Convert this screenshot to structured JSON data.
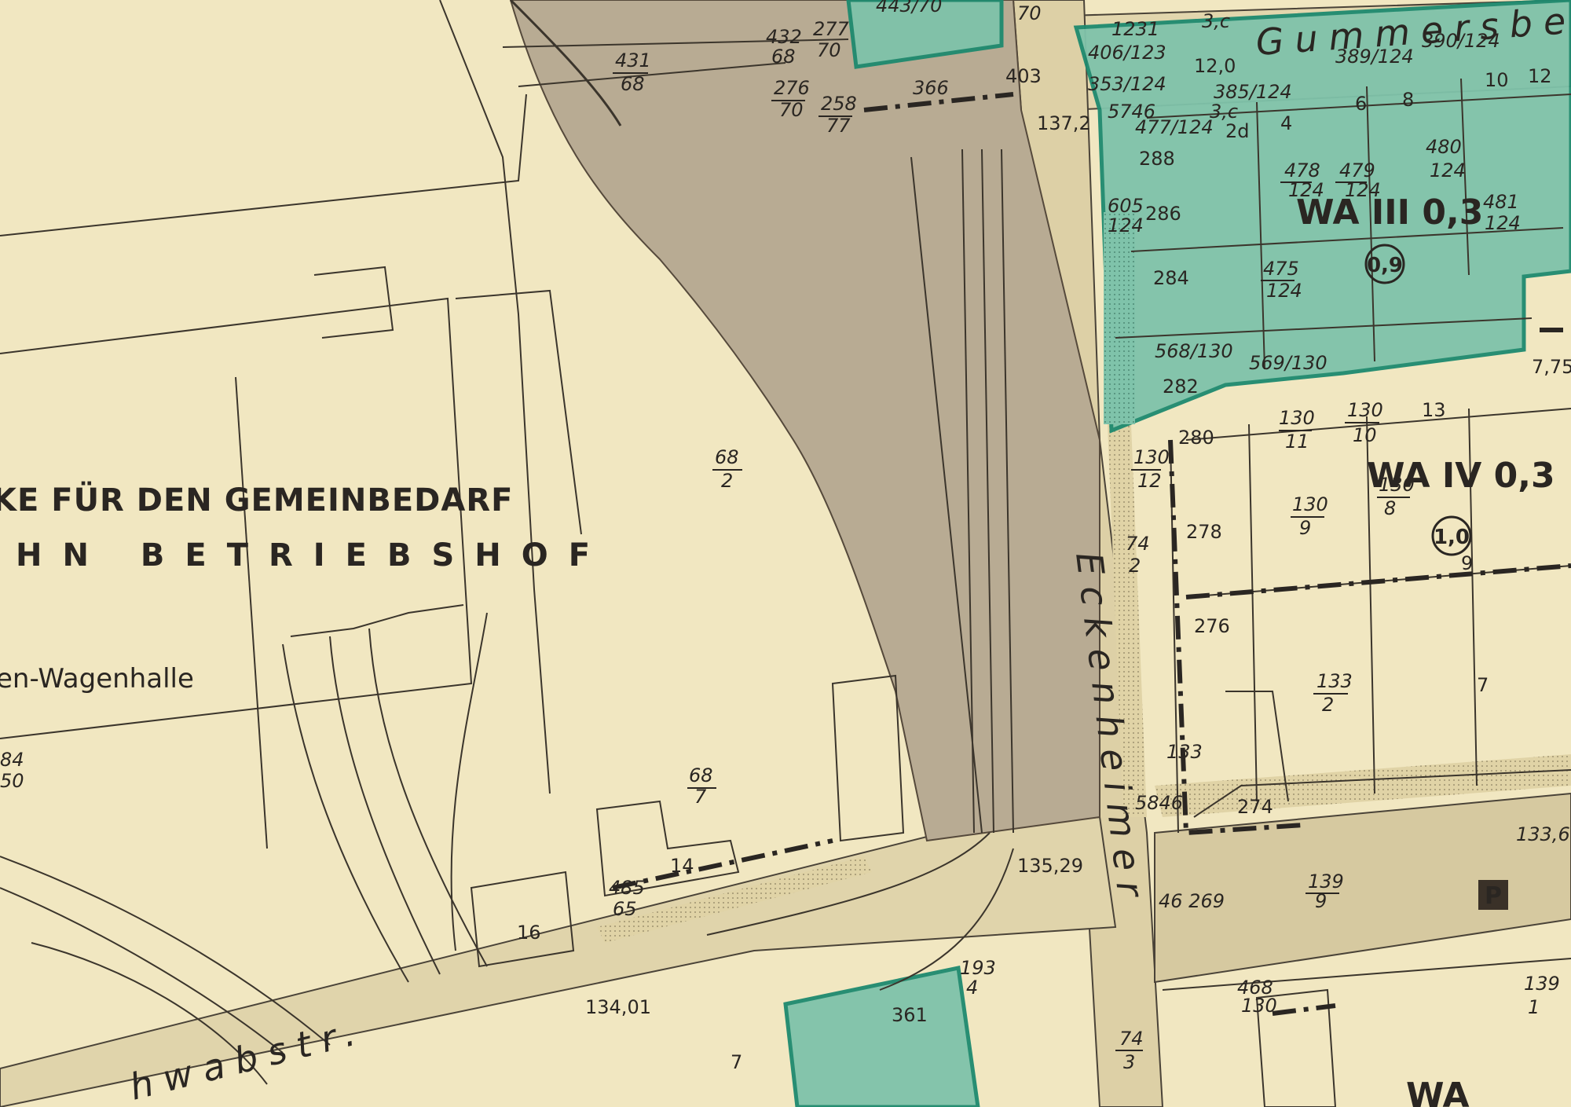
{
  "title_line_1": "KE FÜR DEN GEMEINBEDARF",
  "title_line_2": "HN BETRIEBSHOF",
  "hall_label": "en-Wagenhalle",
  "streets": {
    "gummersbacher": "Gummersbe",
    "eckenheimer": "Eckenheimer",
    "schwab": "hwabstr."
  },
  "zones": {
    "wa3": "WA III 0,3",
    "wa4": "WA IV 0,3",
    "wa_bottom": "WA",
    "gfz_09": "0,9",
    "gfz_10": "1,0"
  },
  "parking_symbol": "P",
  "elevations": [
    "137,2",
    "135,29",
    "134,01",
    "133,6",
    "7,75",
    "12,0"
  ],
  "parcels": {
    "p443_70": "443/70",
    "p70a": "70",
    "p1231": "1231",
    "p3c_top": "3,c",
    "p406": "406/123",
    "p389": "389/124",
    "p390": "390/124",
    "p353": "353/124",
    "p385": "385/124",
    "p477": "477/124",
    "p3c_mid": "3,c",
    "p2d": "2d",
    "p4": "4",
    "p6": "6",
    "p8": "8",
    "p10": "10",
    "p12": "12",
    "p288": "288",
    "p478_n": "478",
    "p478_d": "124",
    "p479_n": "479",
    "p479_d": "124",
    "p480_n": "480",
    "p480_d": "124",
    "p481_n": "481",
    "p481_d": "124",
    "p605_n": "605",
    "p605_d": "124",
    "p286": "286",
    "p284": "284",
    "p475_n": "475",
    "p475_d": "124",
    "p568": "568/130",
    "p569": "569/130",
    "p282": "282",
    "p280": "280",
    "p130_11_n": "130",
    "p130_11_d": "11",
    "p130_10_n": "130",
    "p130_10_d": "10",
    "p13": "13",
    "p130_12_n": "130",
    "p130_12_d": "12",
    "p130_9_n": "130",
    "p130_9_d": "9",
    "p130_8_n": "130",
    "p130_8_d": "8",
    "p278": "278",
    "p9": "9",
    "p74_2_n": "74",
    "p74_2_d": "2",
    "p276": "276",
    "p133_2_n": "133",
    "p133_2_d": "2",
    "p7e": "7",
    "p133": "133",
    "p274": "274",
    "p139_9_n": "139",
    "p139_9_d": "9",
    "p468_n": "468",
    "p468_d": "130",
    "p139_1_n": "139",
    "p139_1_d": "1",
    "p431_n": "431",
    "p431_d": "68",
    "p432_n": "432",
    "p432_d": "68",
    "p277_n": "277",
    "p277_d": "70",
    "p276_70_n": "276",
    "p276_70_d": "70",
    "p258_n": "258",
    "p258_d": "77",
    "p403": "403",
    "p366": "366",
    "p68_2_n": "68",
    "p68_2_d": "2",
    "p68_7_n": "68",
    "p68_7_d": "7",
    "p14": "14",
    "p16": "16",
    "p485_n": "485",
    "p485_d": "65",
    "p84_n": "84",
    "p84_d": "50",
    "p193_n": "193",
    "p193_d": "4",
    "p361": "361",
    "p7w": "7",
    "p74_3_n": "74",
    "p74_3_d": "3",
    "p5746": "5746",
    "p5846": "5846",
    "p46269": "46 269"
  }
}
